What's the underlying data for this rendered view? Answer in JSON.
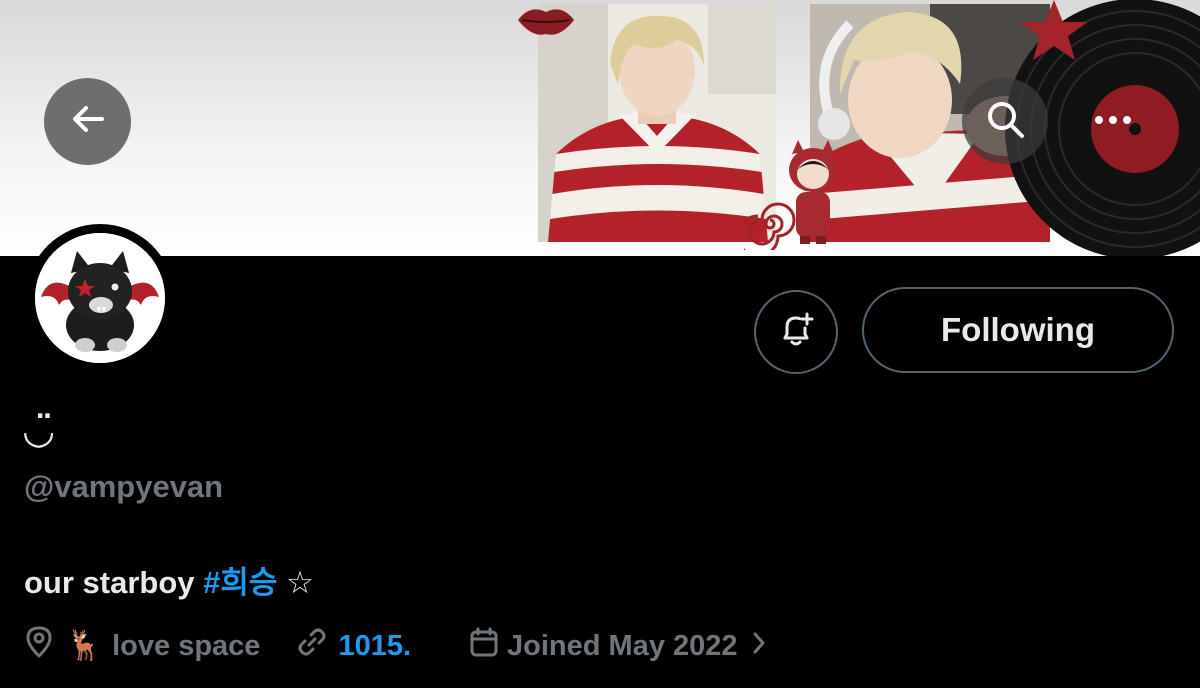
{
  "header": {
    "back_label": "Back",
    "search_label": "Search",
    "more_label": "More"
  },
  "profile": {
    "display_name": "◡̈",
    "username": "@vampyevan",
    "bio_text": "our starboy",
    "bio_hashtag": "#희승",
    "bio_symbol": "☆",
    "location_emoji": "🦌",
    "location": "love space",
    "link": "1015.",
    "joined": "Joined May 2022"
  },
  "actions": {
    "following_label": "Following",
    "notify_label": "Notifications"
  },
  "icons": {
    "back": "arrow-left-icon",
    "search": "search-icon",
    "more": "more-horizontal-icon",
    "notify": "bell-plus-icon",
    "location": "location-pin-icon",
    "link": "link-icon",
    "calendar": "calendar-icon",
    "chevron": "chevron-right-icon"
  },
  "colors": {
    "background": "#000000",
    "text_primary": "#e7e9ea",
    "text_secondary": "#71767b",
    "accent_link": "#1d9bf0",
    "button_border": "#536471"
  }
}
